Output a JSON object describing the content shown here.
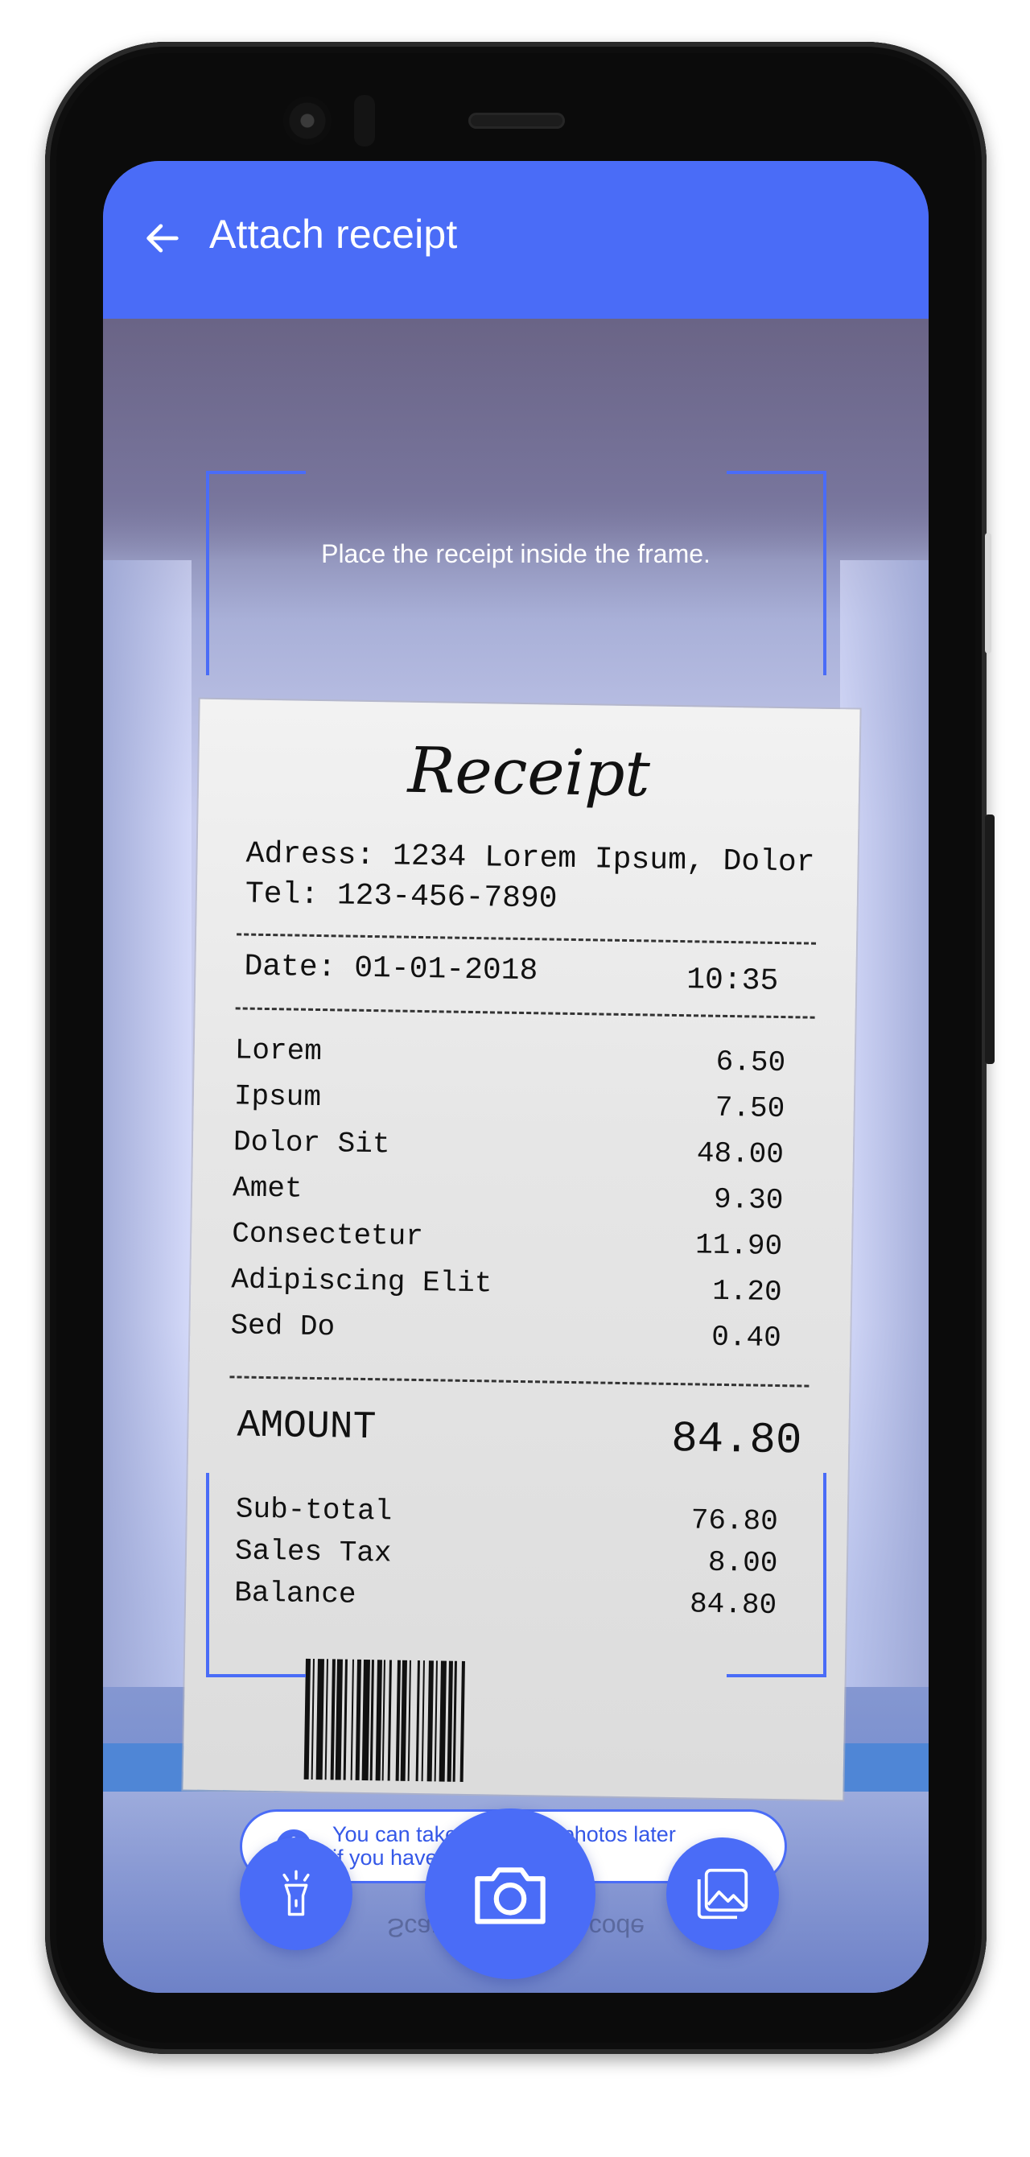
{
  "appbar": {
    "title": "Attach receipt"
  },
  "camera": {
    "instruction": "Place the receipt inside the frame."
  },
  "receipt": {
    "title": "Receipt",
    "address": "Adress: 1234 Lorem Ipsum, Dolor",
    "tel": "Tel: 123-456-7890",
    "date": "Date: 01-01-2018",
    "time": "10:35",
    "items": [
      {
        "name": "Lorem",
        "price": "6.50"
      },
      {
        "name": "Ipsum",
        "price": "7.50"
      },
      {
        "name": "Dolor Sit",
        "price": "48.00"
      },
      {
        "name": "Amet",
        "price": "9.30"
      },
      {
        "name": "Consectetur",
        "price": "11.90"
      },
      {
        "name": "Adipiscing Elit",
        "price": "1.20"
      },
      {
        "name": "Sed Do",
        "price": "0.40"
      }
    ],
    "amount_label": "AMOUNT",
    "amount_value": "84.80",
    "subtotal_label": "Sub-total",
    "subtotal_value": "76.80",
    "tax_label": "Sales Tax",
    "tax_value": "8.00",
    "balance_label": "Balance",
    "balance_value": "84.80"
  },
  "tip": {
    "text_line1": "You can take additional photos later",
    "text_line2": "if you have a long receipt."
  },
  "controls": {
    "flash_icon": "flashlight-icon",
    "capture_icon": "camera-icon",
    "gallery_icon": "gallery-icon"
  },
  "colors": {
    "accent": "#4a6cf7",
    "frame": "#4a6cf7"
  }
}
